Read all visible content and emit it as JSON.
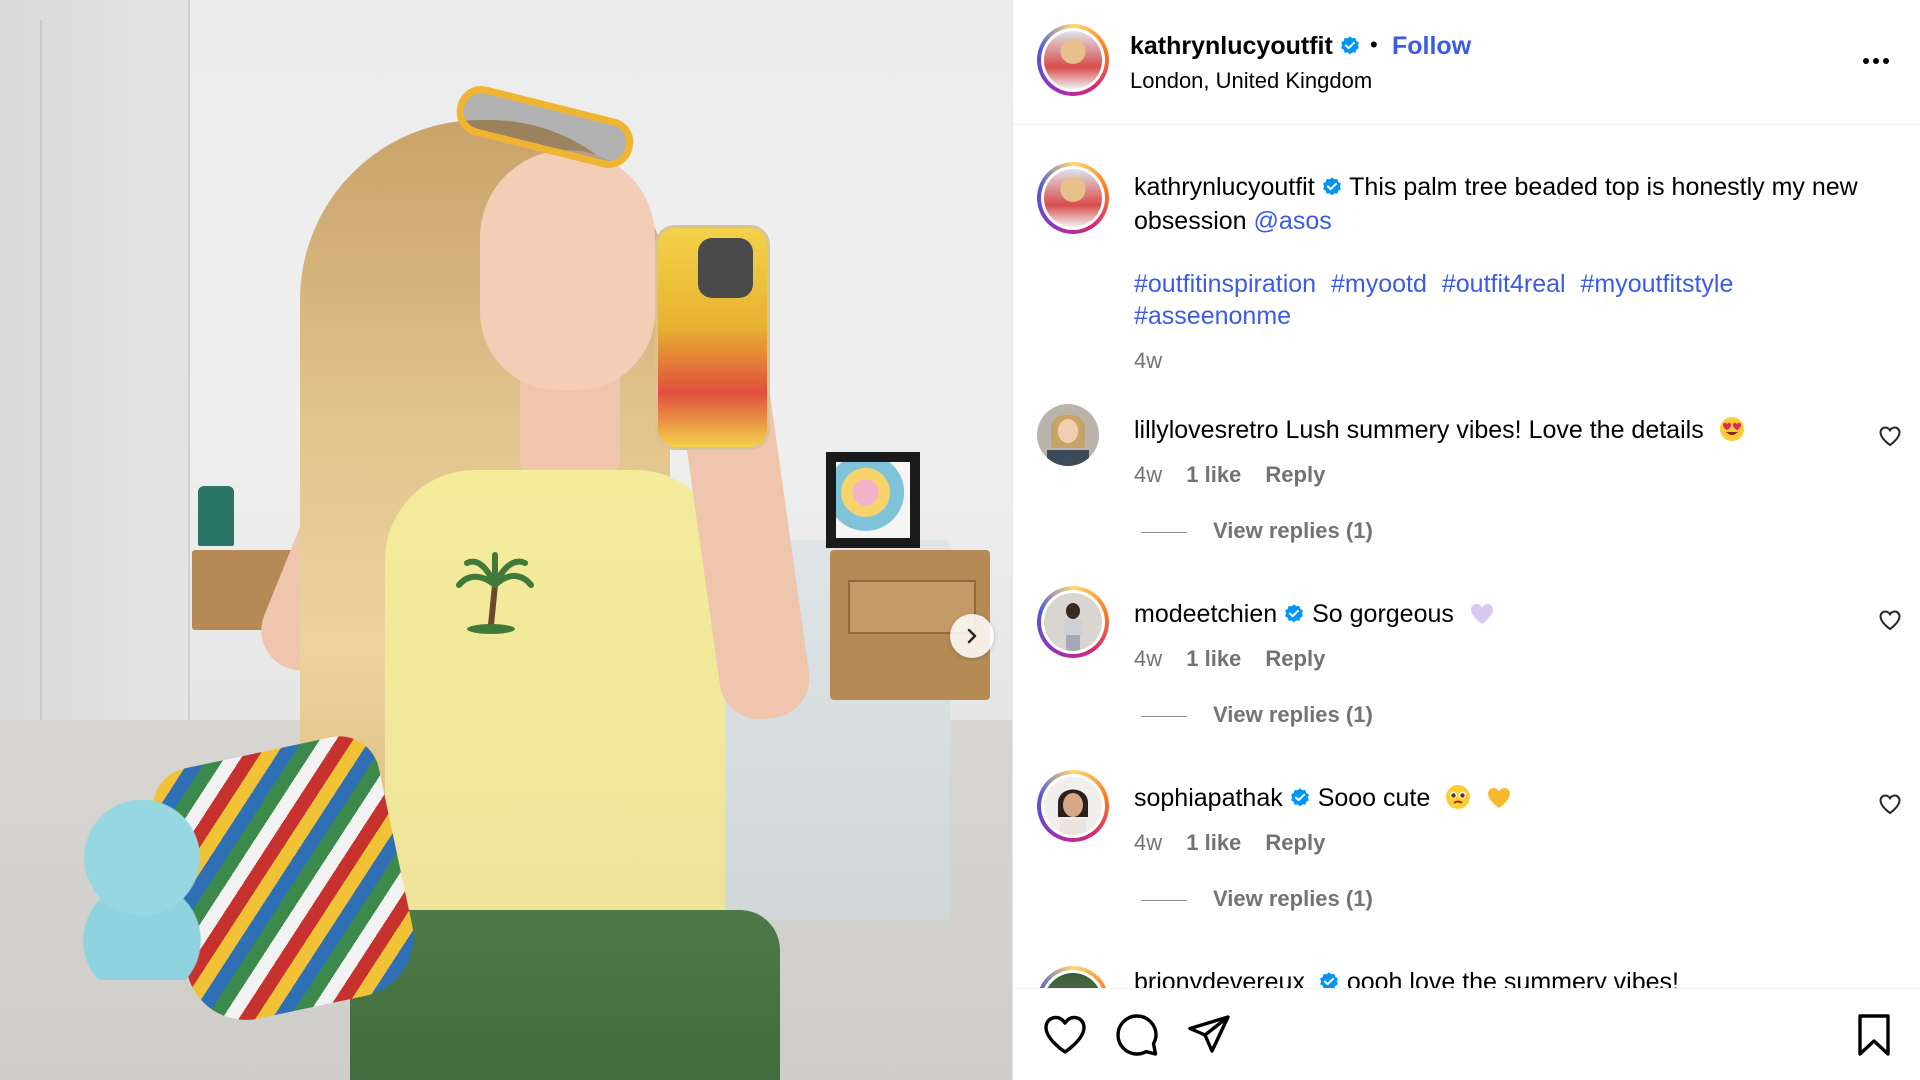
{
  "post": {
    "username": "kathrynlucyoutfit",
    "follow_label": "Follow",
    "separator": "•",
    "location": "London, United Kingdom",
    "more_icon": "more-horizontal-icon"
  },
  "caption": {
    "username": "kathrynlucyoutfit",
    "text": "This palm tree beaded top is honestly my new obsession",
    "mention": "@asos",
    "hashtags": [
      "#outfitinspiration",
      "#myootd",
      "#outfit4real",
      "#myoutfitstyle",
      "#asseenonme"
    ],
    "time": "4w"
  },
  "comments": [
    {
      "username": "lillylovesretro",
      "verified": false,
      "text": "Lush summery vibes! Love the details",
      "emoji": "heart-eyes-emoji",
      "time": "4w",
      "likes": "1 like",
      "reply_label": "Reply",
      "view_replies": "View replies (1)"
    },
    {
      "username": "modeetchien",
      "verified": true,
      "text": "So gorgeous",
      "emoji": "purple-heart-emoji",
      "time": "4w",
      "likes": "1 like",
      "reply_label": "Reply",
      "view_replies": "View replies (1)"
    },
    {
      "username": "sophiapathak",
      "verified": true,
      "text": "Sooo cute",
      "emoji": "pleading-face-and-yellow-heart-emoji",
      "time": "4w",
      "likes": "1 like",
      "reply_label": "Reply",
      "view_replies": "View replies (1)"
    }
  ],
  "partial_comment": {
    "username": "brionydevereux",
    "text": "oooh love the summery vibes!"
  },
  "actions": {
    "like_icon": "heart-icon",
    "comment_icon": "comment-icon",
    "share_icon": "send-icon",
    "save_icon": "bookmark-icon"
  },
  "colors": {
    "link": "#3a5be6",
    "verified": "#0095f6",
    "muted_text": "#737373"
  }
}
